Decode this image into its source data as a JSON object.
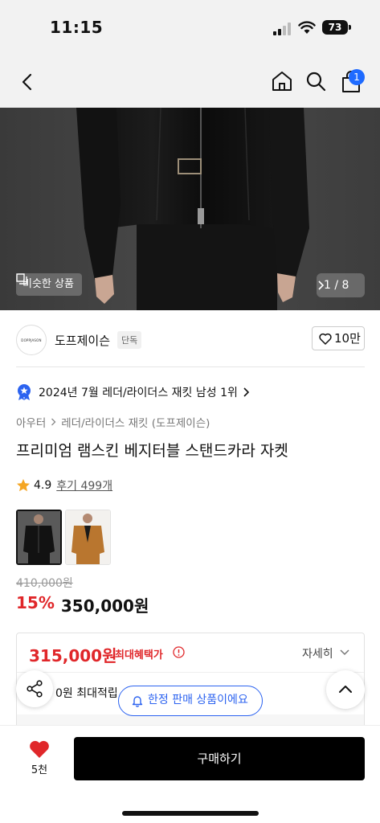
{
  "status_bar": {
    "time": "11:15",
    "battery": "73"
  },
  "nav": {
    "cart_count": "1"
  },
  "gallery": {
    "similar_label": "비슷한 상품",
    "pager": "1 / 8"
  },
  "brand": {
    "logo_text": "DOPPJASON",
    "name": "도프제이슨",
    "tag": "단독",
    "likes": "10만"
  },
  "ranking": {
    "text": "2024년 7월 레더/라이더스 재킷 남성 1위"
  },
  "breadcrumb": {
    "category": "아우터",
    "subcategory": "레더/라이더스 재킷 (도프제이슨)"
  },
  "product": {
    "title": "프리미엄 램스킨 베지터블 스탠드카라 자켓",
    "rating": "4.9",
    "reviews": "후기 499개",
    "original_price": "410,000원",
    "discount": "15%",
    "price": "350,000원"
  },
  "benefit": {
    "price": "315,000원",
    "label": "최대혜택가",
    "detail": "자세히",
    "points": "0원 최대적립"
  },
  "limited_label": "한정 판매 상품이에요",
  "bottom": {
    "likes": "5천",
    "buy_label": "구매하기"
  },
  "colors": {
    "accent_red": "#e0272a",
    "accent_blue": "#2c63f0",
    "badge_blue": "#1f6bff"
  }
}
